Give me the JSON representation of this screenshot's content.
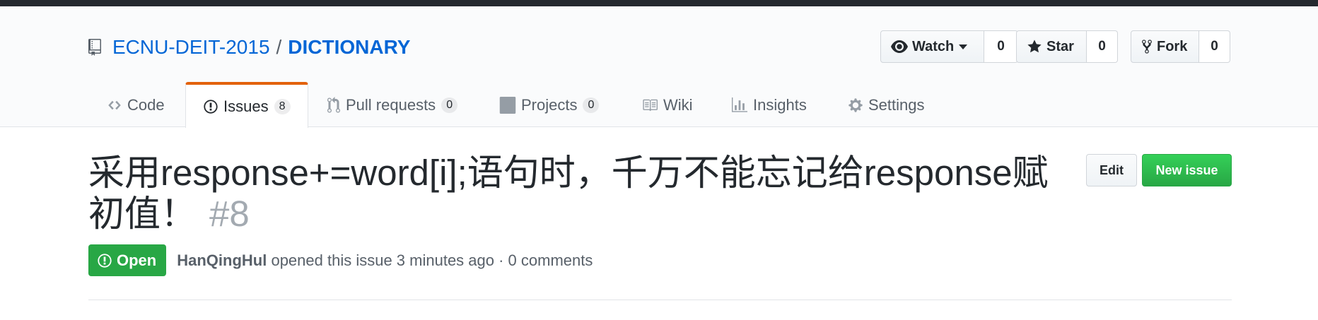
{
  "repo": {
    "owner": "ECNU-DEIT-2015",
    "separator": "/",
    "name": "DICTIONARY"
  },
  "actions": {
    "watch": {
      "label": "Watch",
      "count": "0"
    },
    "star": {
      "label": "Star",
      "count": "0"
    },
    "fork": {
      "label": "Fork",
      "count": "0"
    }
  },
  "tabs": {
    "code": {
      "label": "Code"
    },
    "issues": {
      "label": "Issues",
      "count": "8"
    },
    "pulls": {
      "label": "Pull requests",
      "count": "0"
    },
    "projects": {
      "label": "Projects",
      "count": "0"
    },
    "wiki": {
      "label": "Wiki"
    },
    "insights": {
      "label": "Insights"
    },
    "settings": {
      "label": "Settings"
    }
  },
  "issue": {
    "title": "采用response+=word[i];语句时，千万不能忘记给response赋初值！",
    "number": "#8",
    "state": "Open",
    "author": "HanQingHul",
    "meta": " opened this issue 3 minutes ago · 0 comments",
    "edit_label": "Edit",
    "new_label": "New issue"
  },
  "colors": {
    "accent": "#0366d6",
    "tab_underline": "#e36209",
    "open_state": "#28a745",
    "topbar": "#24292e"
  },
  "icons": [
    "repo-icon",
    "eye-icon",
    "star-icon",
    "fork-icon",
    "code-icon",
    "issue-opened-icon",
    "git-pull-request-icon",
    "project-icon",
    "book-icon",
    "graph-icon",
    "gear-icon"
  ]
}
